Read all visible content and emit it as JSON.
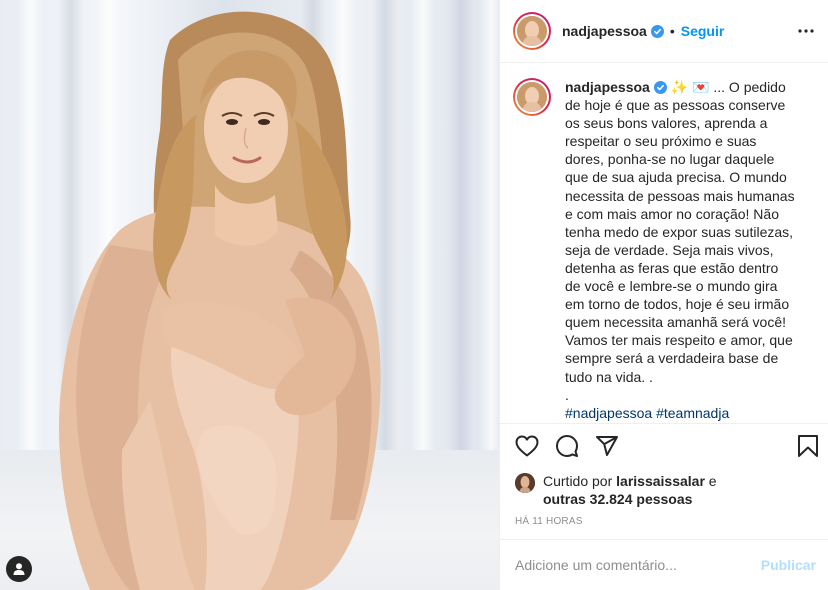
{
  "post": {
    "username": "nadjapessoa",
    "follow_label": "Seguir",
    "dot": "•",
    "caption_emoji": "✨ 💌",
    "caption_lines": [
      "... O pedido",
      "de hoje é que as pessoas conserve",
      "os seus bons valores, aprenda a",
      "respeitar o seu próximo e suas",
      "dores, ponha-se no lugar daquele",
      "que de sua ajuda precisa. O mundo",
      "necessita de pessoas mais humanas",
      "e com mais amor no coração! Não",
      "tenha medo de expor suas sutilezas,",
      "seja de verdade. Seja mais vivos,",
      "detenha as feras que estão dentro",
      "de você e lembre-se o mundo gira",
      "em torno de todos, hoje é seu irmão",
      "quem necessita amanhã será você!",
      "Vamos ter mais respeito e amor, que",
      "sempre será a verdadeira base de",
      "tudo na vida. .",
      "."
    ],
    "hashtags": [
      "#nadjapessoa",
      "#teamnadja"
    ],
    "likes_prefix": "Curtido por",
    "liked_by_user": "larissaissalar",
    "likes_and": "e",
    "likes_others": "outras 32.824 pessoas",
    "timestamp": "Há 11 horas",
    "comment_placeholder": "Adicione um comentário...",
    "publish_label": "Publicar"
  },
  "colors": {
    "accent": "#0095f6",
    "publish_disabled": "#b2dffc",
    "text": "#262626",
    "muted": "#8e8e8e",
    "hashtag": "#00376b"
  },
  "icons": [
    "verified-badge-icon",
    "more-options-icon",
    "heart-icon",
    "comment-icon",
    "share-icon",
    "bookmark-icon",
    "user-icon"
  ]
}
